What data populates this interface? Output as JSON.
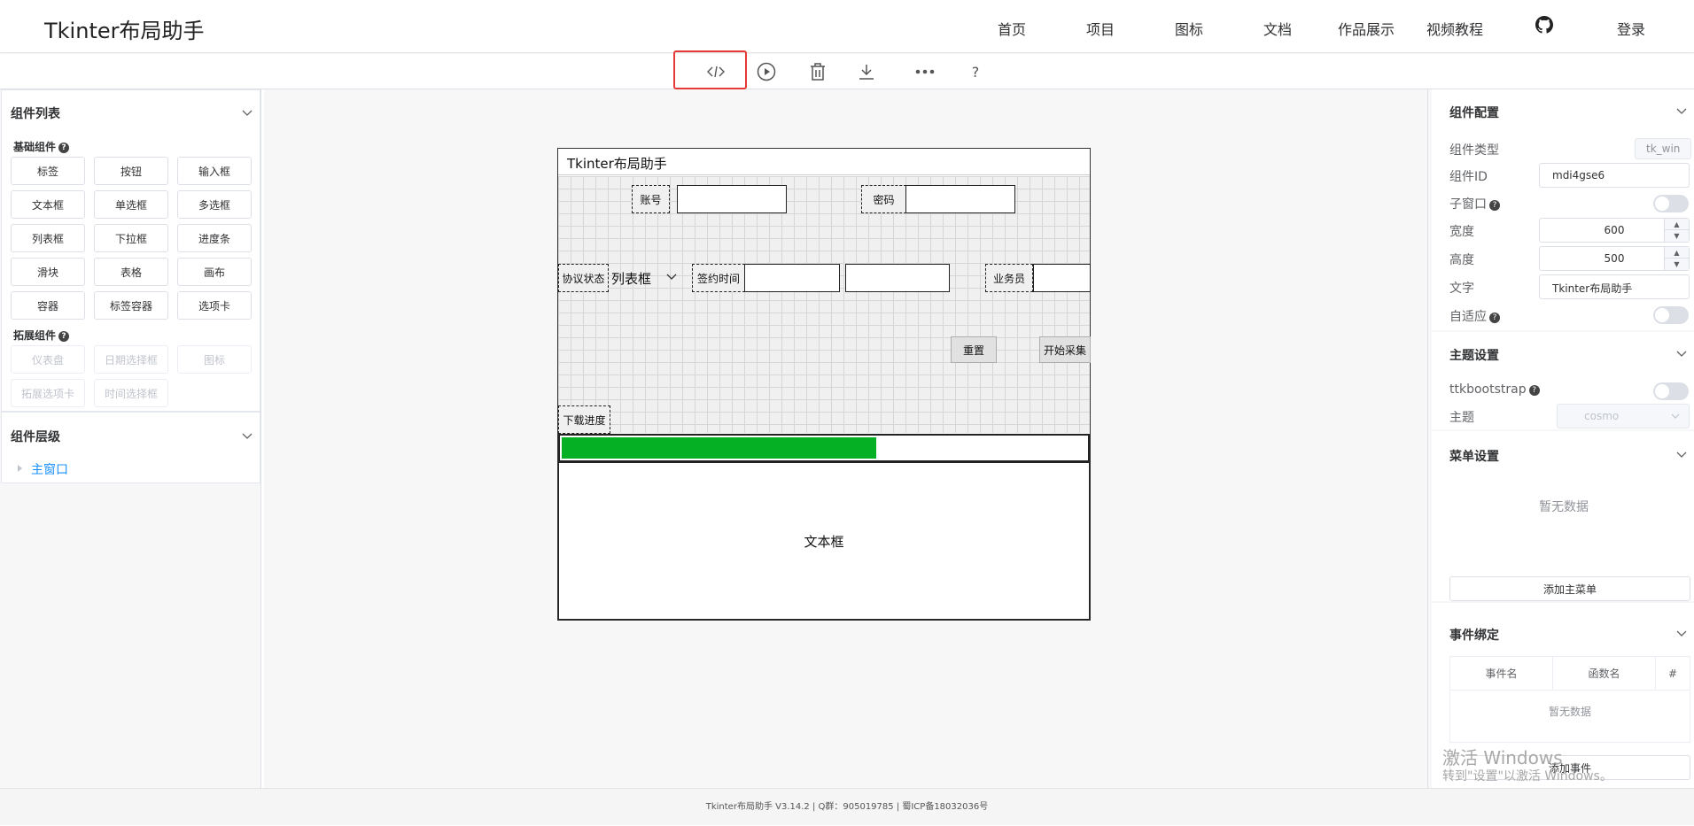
{
  "nav": {
    "brand": "Tkinter布局助手",
    "links": [
      "首页",
      "项目",
      "图标",
      "文档",
      "作品展示",
      "视频教程"
    ],
    "login": "登录"
  },
  "toolbar": {
    "icons": [
      "code-icon",
      "play-icon",
      "trash-icon",
      "download-icon",
      "more-icon",
      "help-icon"
    ],
    "help_label": "?"
  },
  "left": {
    "components_title": "组件列表",
    "basic_title": "基础组件",
    "basic": [
      "标签",
      "按钮",
      "输入框",
      "文本框",
      "单选框",
      "多选框",
      "列表框",
      "下拉框",
      "进度条",
      "滑块",
      "表格",
      "画布",
      "容器",
      "标签容器",
      "选项卡"
    ],
    "extended_title": "拓展组件",
    "extended": [
      "仪表盘",
      "日期选择框",
      "图标",
      "拓展选项卡",
      "时间选择框"
    ],
    "hierarchy_title": "组件层级",
    "tree_root": "主窗口"
  },
  "preview": {
    "title": "Tkinter布局助手",
    "account_label": "账号",
    "password_label": "密码",
    "status_label": "协议状态",
    "combo_value": "列表框",
    "sign_time_label": "签约时间",
    "salesman_label": "业务员",
    "reset_button": "重置",
    "start_button": "开始采集",
    "progress_label": "下载进度",
    "progress_value": 0.6,
    "textbox_label": "文本框"
  },
  "right": {
    "config_title": "组件配置",
    "type_label": "组件类型",
    "type_value": "tk_win",
    "id_label": "组件ID",
    "id_value": "mdi4gse6",
    "subwin_label": "子窗口",
    "width_label": "宽度",
    "width_value": "600",
    "height_label": "高度",
    "height_value": "500",
    "text_label": "文字",
    "text_value": "Tkinter布局助手",
    "adaptive_label": "自适应",
    "theme_title": "主题设置",
    "ttkb_label": "ttkbootstrap",
    "theme_label": "主题",
    "theme_value": "cosmo",
    "menu_title": "菜单设置",
    "menu_empty": "暂无数据",
    "add_menu": "添加主菜单",
    "event_title": "事件绑定",
    "event_cols": [
      "事件名",
      "函数名",
      "#"
    ],
    "event_empty": "暂无数据",
    "add_event": "添加事件"
  },
  "watermark": {
    "line1": "激活 Windows",
    "line2": "转到\"设置\"以激活 Windows。"
  },
  "footer": "Tkinter布局助手 V3.14.2 | Q群：905019785 | 蜀ICP备18032036号"
}
